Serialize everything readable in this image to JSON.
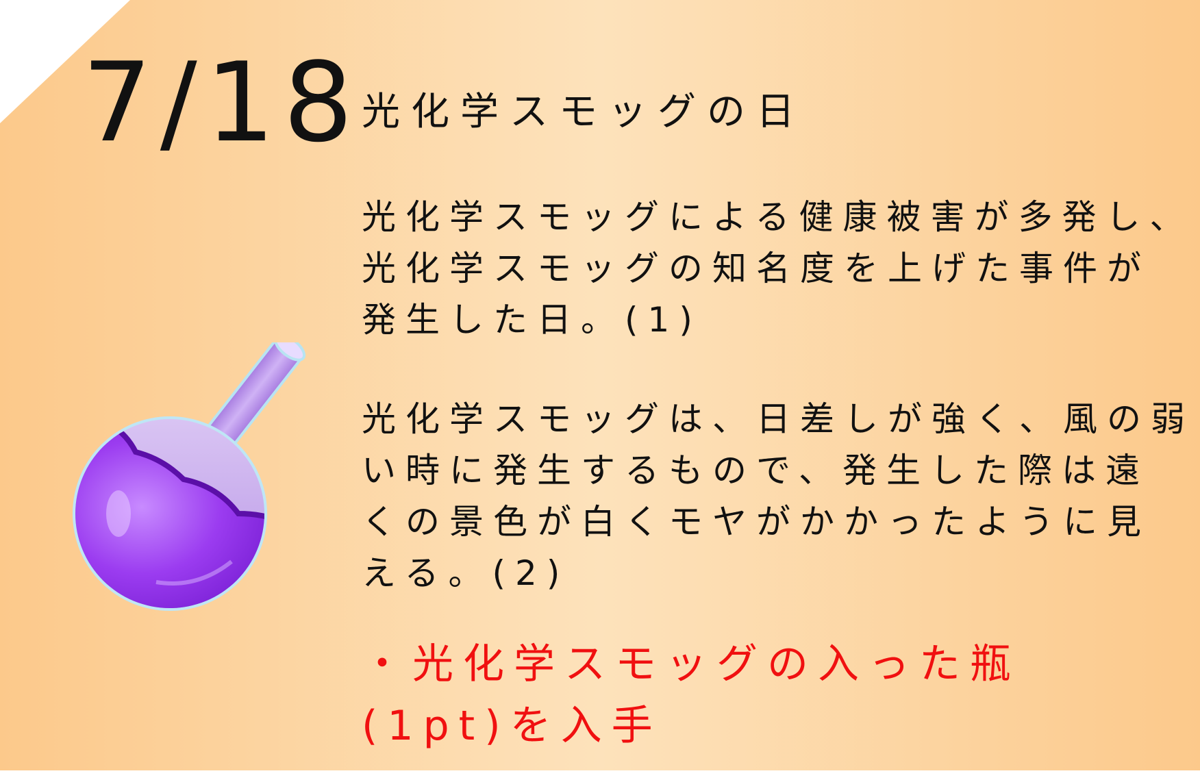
{
  "date": "7/18",
  "title": "光化学スモッグの日",
  "paragraph1": [
    "光化学スモッグによる健康被害が多発し、",
    "光化学スモッグの知名度を上げた事件が",
    "発生した日。(1)"
  ],
  "paragraph2": [
    "光化学スモッグは、日差しが強く、風の弱",
    "い時に発生するもので、発生した際は遠",
    "くの景色が白くモヤがかかったように見",
    "える。(2)"
  ],
  "reward": [
    "・光化学スモッグの入った瓶",
    "(1pt)を入手"
  ],
  "icon": "smog-flask-icon",
  "colors": {
    "background_edge": "#fcc98b",
    "background_center": "#fde2bb",
    "text": "#111111",
    "reward": "#f01010",
    "flask_purple": "#8a2be2"
  }
}
